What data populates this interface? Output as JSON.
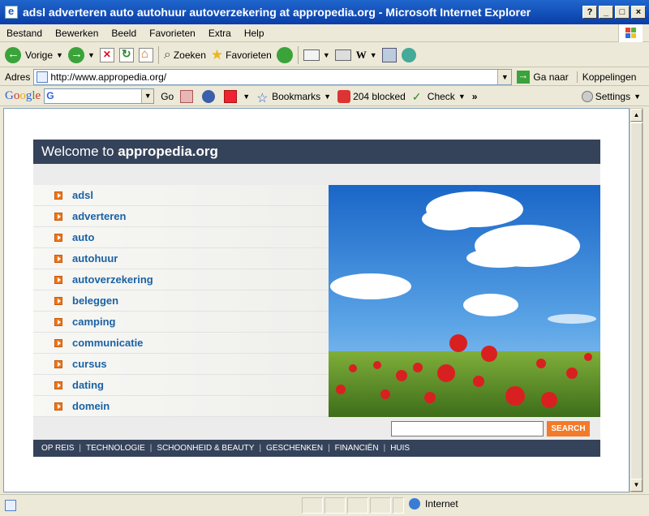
{
  "window": {
    "title": "adsl adverteren auto autohuur autoverzekering at appropedia.org - Microsoft Internet Explorer",
    "buttons": {
      "help": "?",
      "minimize": "_",
      "maximize": "□",
      "close": "×"
    }
  },
  "menu": [
    "Bestand",
    "Bewerken",
    "Beeld",
    "Favorieten",
    "Extra",
    "Help"
  ],
  "toolbar": {
    "back_label": "Vorige",
    "search_label": "Zoeken",
    "favorites_label": "Favorieten",
    "word_icon_text": "W"
  },
  "address": {
    "label": "Adres",
    "url": "http://www.appropedia.org/",
    "go_label": "Ga naar",
    "links_label": "Koppelingen"
  },
  "googlebar": {
    "logo": [
      "G",
      "o",
      "o",
      "g",
      "l",
      "e"
    ],
    "go_label": "Go",
    "bookmarks_label": "Bookmarks",
    "blocked_label": "204 blocked",
    "check_label": "Check",
    "more": "»",
    "settings_label": "Settings"
  },
  "site": {
    "welcome": "Welcome to",
    "domain": "appropedia.org",
    "links": [
      "adsl",
      "adverteren",
      "auto",
      "autohuur",
      "autoverzekering",
      "beleggen",
      "camping",
      "communicatie",
      "cursus",
      "dating",
      "domein"
    ],
    "search_button": "SEARCH",
    "search_value": "",
    "bottom_nav": [
      "OP REIS",
      "TECHNOLOGIE",
      "SCHOONHEID & BEAUTY",
      "GESCHENKEN",
      "FINANCIËN",
      "HUIS"
    ]
  },
  "status": {
    "zone": "Internet"
  }
}
